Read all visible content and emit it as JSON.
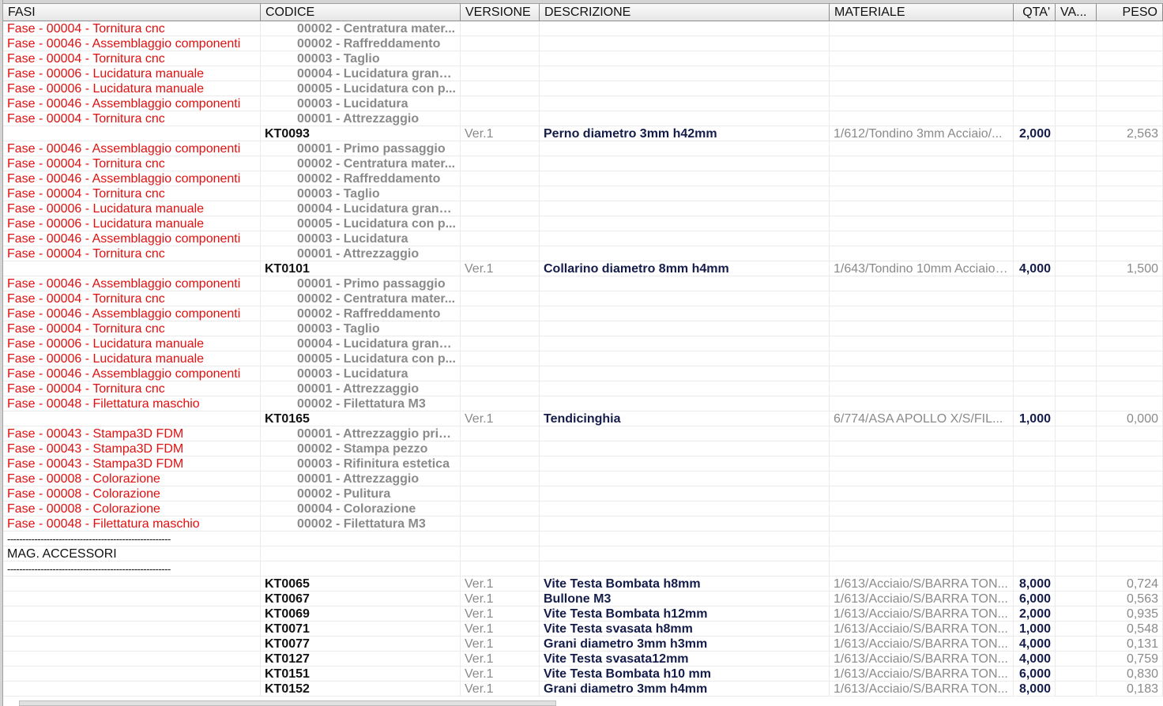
{
  "columns": {
    "fasi": "FASI",
    "codice": "CODICE",
    "versione": "VERSIONE",
    "descrizione": "DESCRIZIONE",
    "materiale": "MATERIALE",
    "qta": "QTA'",
    "va": "VA...",
    "peso": "PESO"
  },
  "rows": [
    {
      "type": "fase",
      "fase": "Fase - 00004 - Tornitura cnc",
      "sub": "00002 - Centratura mater..."
    },
    {
      "type": "fase",
      "fase": "Fase - 00046 - Assemblaggio componenti",
      "sub": "00002 - Raffreddamento"
    },
    {
      "type": "fase",
      "fase": "Fase - 00004 - Tornitura cnc",
      "sub": "00003 - Taglio"
    },
    {
      "type": "fase",
      "fase": "Fase - 00006 - Lucidatura manuale",
      "sub": "00004 - Lucidatura grana..."
    },
    {
      "type": "fase",
      "fase": "Fase - 00006 - Lucidatura manuale",
      "sub": "00005 - Lucidatura con p..."
    },
    {
      "type": "fase",
      "fase": "Fase - 00046 - Assemblaggio componenti",
      "sub": "00003 - Lucidatura"
    },
    {
      "type": "fase",
      "fase": "Fase - 00004 - Tornitura cnc",
      "sub": "00001 - Attrezzaggio"
    },
    {
      "type": "item",
      "code": "KT0093",
      "ver": "Ver.1",
      "desc": "Perno diametro 3mm h42mm",
      "mat": "1/612/Tondino 3mm Acciaio/...",
      "qta": "2,000",
      "peso": "2,563"
    },
    {
      "type": "fase",
      "fase": "Fase - 00046 - Assemblaggio componenti",
      "sub": "00001 - Primo passaggio"
    },
    {
      "type": "fase",
      "fase": "Fase - 00004 - Tornitura cnc",
      "sub": "00002 - Centratura mater..."
    },
    {
      "type": "fase",
      "fase": "Fase - 00046 - Assemblaggio componenti",
      "sub": "00002 - Raffreddamento"
    },
    {
      "type": "fase",
      "fase": "Fase - 00004 - Tornitura cnc",
      "sub": "00003 - Taglio"
    },
    {
      "type": "fase",
      "fase": "Fase - 00006 - Lucidatura manuale",
      "sub": "00004 - Lucidatura grana..."
    },
    {
      "type": "fase",
      "fase": "Fase - 00006 - Lucidatura manuale",
      "sub": "00005 - Lucidatura con p..."
    },
    {
      "type": "fase",
      "fase": "Fase - 00046 - Assemblaggio componenti",
      "sub": "00003 - Lucidatura"
    },
    {
      "type": "fase",
      "fase": "Fase - 00004 - Tornitura cnc",
      "sub": "00001 - Attrezzaggio"
    },
    {
      "type": "item",
      "code": "KT0101",
      "ver": "Ver.1",
      "desc": "Collarino diametro 8mm h4mm",
      "mat": "1/643/Tondino 10mm Acciaio/...",
      "qta": "4,000",
      "peso": "1,500"
    },
    {
      "type": "fase",
      "fase": "Fase - 00046 - Assemblaggio componenti",
      "sub": "00001 - Primo passaggio"
    },
    {
      "type": "fase",
      "fase": "Fase - 00004 - Tornitura cnc",
      "sub": "00002 - Centratura mater..."
    },
    {
      "type": "fase",
      "fase": "Fase - 00046 - Assemblaggio componenti",
      "sub": "00002 - Raffreddamento"
    },
    {
      "type": "fase",
      "fase": "Fase - 00004 - Tornitura cnc",
      "sub": "00003 - Taglio"
    },
    {
      "type": "fase",
      "fase": "Fase - 00006 - Lucidatura manuale",
      "sub": "00004 - Lucidatura grana..."
    },
    {
      "type": "fase",
      "fase": "Fase - 00006 - Lucidatura manuale",
      "sub": "00005 - Lucidatura con p..."
    },
    {
      "type": "fase",
      "fase": "Fase - 00046 - Assemblaggio componenti",
      "sub": "00003 - Lucidatura"
    },
    {
      "type": "fase",
      "fase": "Fase - 00004 - Tornitura cnc",
      "sub": "00001 - Attrezzaggio"
    },
    {
      "type": "fase",
      "fase": "Fase - 00048 - Filettatura maschio",
      "sub": "00002 - Filettatura M3"
    },
    {
      "type": "item",
      "code": "KT0165",
      "ver": "Ver.1",
      "desc": "Tendicinghia",
      "mat": "6/774/ASA APOLLO X/S/FIL...",
      "qta": "1,000",
      "peso": "0,000"
    },
    {
      "type": "fase",
      "fase": "Fase - 00043 - Stampa3D FDM",
      "sub": "00001 - Attrezzaggio prin..."
    },
    {
      "type": "fase",
      "fase": "Fase - 00043 - Stampa3D FDM",
      "sub": "00002 - Stampa pezzo"
    },
    {
      "type": "fase",
      "fase": "Fase - 00043 - Stampa3D FDM",
      "sub": "00003 - Rifinitura estetica"
    },
    {
      "type": "fase",
      "fase": "Fase - 00008 - Colorazione",
      "sub": "00001 - Attrezzaggio"
    },
    {
      "type": "fase",
      "fase": "Fase - 00008 - Colorazione",
      "sub": "00002 - Pulitura"
    },
    {
      "type": "fase",
      "fase": "Fase - 00008 - Colorazione",
      "sub": "00004 - Colorazione"
    },
    {
      "type": "fase",
      "fase": "Fase - 00048 - Filettatura maschio",
      "sub": "00002 - Filettatura M3"
    },
    {
      "type": "text",
      "text": "------------------------------------------------------"
    },
    {
      "type": "text",
      "text": "MAG. ACCESSORI"
    },
    {
      "type": "text",
      "text": "------------------------------------------------------"
    },
    {
      "type": "item",
      "code": "KT0065",
      "ver": "Ver.1",
      "desc": "Vite Testa Bombata h8mm",
      "mat": "1/613/Acciaio/S/BARRA TON...",
      "qta": "8,000",
      "peso": "0,724"
    },
    {
      "type": "item",
      "code": "KT0067",
      "ver": "Ver.1",
      "desc": "Bullone M3",
      "mat": "1/613/Acciaio/S/BARRA TON...",
      "qta": "6,000",
      "peso": "0,563"
    },
    {
      "type": "item",
      "code": "KT0069",
      "ver": "Ver.1",
      "desc": "Vite Testa Bombata h12mm",
      "mat": "1/613/Acciaio/S/BARRA TON...",
      "qta": "2,000",
      "peso": "0,935"
    },
    {
      "type": "item",
      "code": "KT0071",
      "ver": "Ver.1",
      "desc": "Vite Testa svasata h8mm",
      "mat": "1/613/Acciaio/S/BARRA TON...",
      "qta": "1,000",
      "peso": "0,548"
    },
    {
      "type": "item",
      "code": "KT0077",
      "ver": "Ver.1",
      "desc": "Grani diametro 3mm h3mm",
      "mat": "1/613/Acciaio/S/BARRA TON...",
      "qta": "4,000",
      "peso": "0,131"
    },
    {
      "type": "item",
      "code": "KT0127",
      "ver": "Ver.1",
      "desc": "Vite Testa svasata12mm",
      "mat": "1/613/Acciaio/S/BARRA TON...",
      "qta": "4,000",
      "peso": "0,759"
    },
    {
      "type": "item",
      "code": "KT0151",
      "ver": "Ver.1",
      "desc": "Vite Testa Bombata h10 mm",
      "mat": "1/613/Acciaio/S/BARRA TON...",
      "qta": "6,000",
      "peso": "0,830"
    },
    {
      "type": "item",
      "code": "KT0152",
      "ver": "Ver.1",
      "desc": "Grani diametro 3mm h4mm",
      "mat": "1/613/Acciaio/S/BARRA TON...",
      "qta": "8,000",
      "peso": "0,183"
    }
  ]
}
